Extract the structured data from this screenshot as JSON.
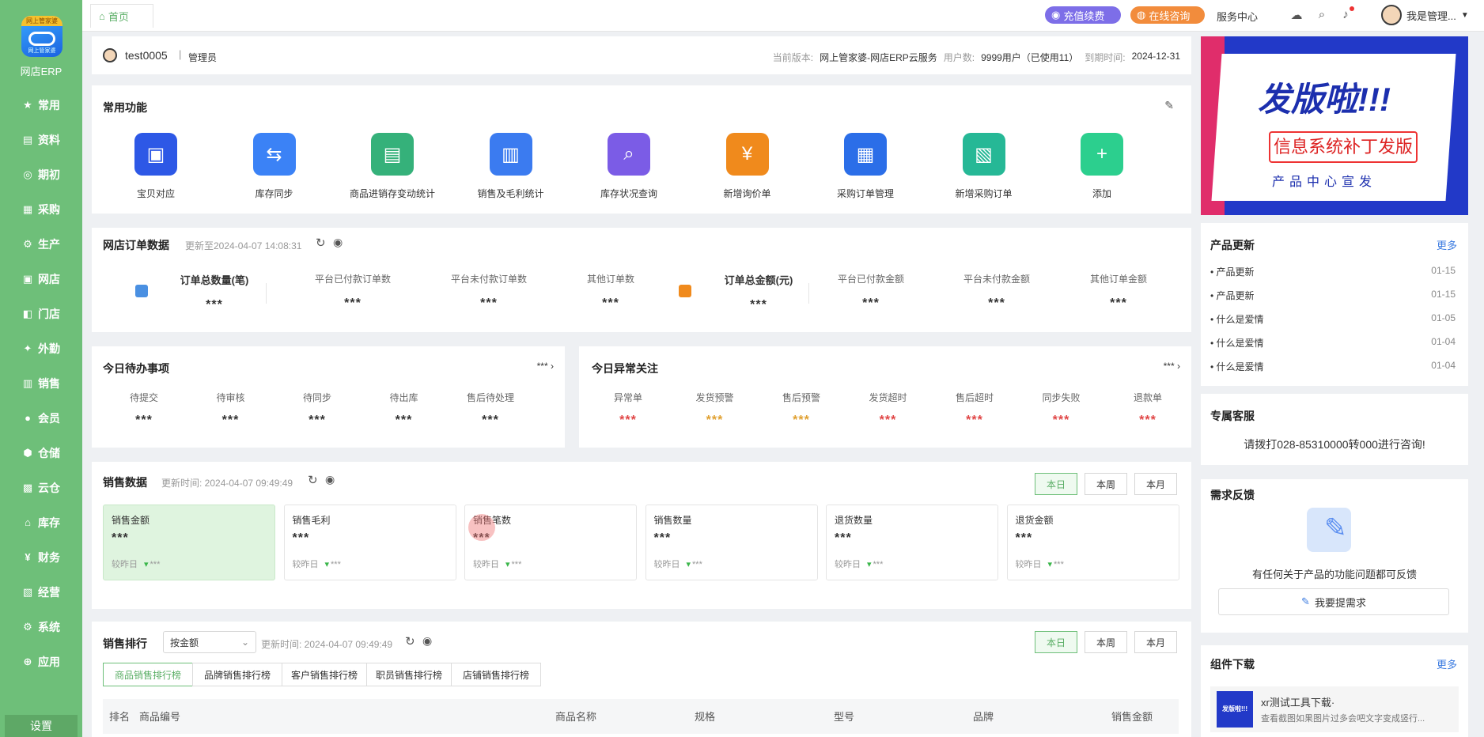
{
  "sidebar": {
    "logo_ribbon": "网上管家婆",
    "logo_sub": "网上管家婆",
    "logo_label": "网店ERP",
    "items": [
      {
        "icon": "★",
        "label": "常用"
      },
      {
        "icon": "▤",
        "label": "资料"
      },
      {
        "icon": "◎",
        "label": "期初"
      },
      {
        "icon": "▦",
        "label": "采购"
      },
      {
        "icon": "⚙",
        "label": "生产"
      },
      {
        "icon": "▣",
        "label": "网店"
      },
      {
        "icon": "◧",
        "label": "门店"
      },
      {
        "icon": "✦",
        "label": "外勤"
      },
      {
        "icon": "▥",
        "label": "销售"
      },
      {
        "icon": "●",
        "label": "会员"
      },
      {
        "icon": "⬢",
        "label": "仓储"
      },
      {
        "icon": "▩",
        "label": "云仓"
      },
      {
        "icon": "⌂",
        "label": "库存"
      },
      {
        "icon": "¥",
        "label": "财务"
      },
      {
        "icon": "▧",
        "label": "经营"
      },
      {
        "icon": "⚙",
        "label": "系统"
      },
      {
        "icon": "⊕",
        "label": "应用"
      }
    ],
    "settings": "设置"
  },
  "topbar": {
    "home_tab": "首页",
    "recharge": "充值续费",
    "consult": "在线咨询",
    "service_center": "服务中心",
    "user": "我是管理..."
  },
  "header": {
    "username": "test0005",
    "role": "管理员",
    "version_label": "当前版本:",
    "version_value": "网上管家婆-网店ERP云服务",
    "users_label": "用户数:",
    "users_value": "9999用户（已使用11）",
    "expiry_label": "到期时间:",
    "expiry_value": "2024-12-31"
  },
  "common_functions": {
    "title": "常用功能",
    "items": [
      {
        "label": "宝贝对应",
        "color": "#2d58e6",
        "icon": "▣"
      },
      {
        "label": "库存同步",
        "color": "#3b82f6",
        "icon": "⇆"
      },
      {
        "label": "商品进销存变动统计",
        "color": "#35b17a",
        "icon": "▤"
      },
      {
        "label": "销售及毛利统计",
        "color": "#3b7bf0",
        "icon": "▥"
      },
      {
        "label": "库存状况查询",
        "color": "#7b5ce6",
        "icon": "⌕"
      },
      {
        "label": "新增询价单",
        "color": "#f08a1c",
        "icon": "¥"
      },
      {
        "label": "采购订单管理",
        "color": "#2b6ee8",
        "icon": "▦"
      },
      {
        "label": "新增采购订单",
        "color": "#26b896",
        "icon": "▧"
      },
      {
        "label": "添加",
        "color": "#2ccf8e",
        "icon": "+"
      }
    ]
  },
  "shop_orders": {
    "title": "网店订单数据",
    "updated": "更新至2024-04-07 14:08:31",
    "count_title": "订单总数量(笔)",
    "count_value": "***",
    "count_cols": [
      {
        "label": "平台已付款订单数",
        "value": "***"
      },
      {
        "label": "平台未付款订单数",
        "value": "***"
      },
      {
        "label": "其他订单数",
        "value": "***"
      }
    ],
    "amount_title": "订单总金额(元)",
    "amount_value": "***",
    "amount_cols": [
      {
        "label": "平台已付款金额",
        "value": "***"
      },
      {
        "label": "平台未付款金额",
        "value": "***"
      },
      {
        "label": "其他订单金额",
        "value": "***"
      }
    ]
  },
  "todo": {
    "title": "今日待办事项",
    "more": "***",
    "items": [
      {
        "label": "待提交",
        "value": "***"
      },
      {
        "label": "待审核",
        "value": "***"
      },
      {
        "label": "待同步",
        "value": "***"
      },
      {
        "label": "待出库",
        "value": "***"
      },
      {
        "label": "售后待处理",
        "value": "***"
      }
    ]
  },
  "abnormal": {
    "title": "今日异常关注",
    "more": "***",
    "items": [
      {
        "label": "异常单",
        "value": "***",
        "color": "#e04545"
      },
      {
        "label": "发货预警",
        "value": "***",
        "color": "#e0a030"
      },
      {
        "label": "售后预警",
        "value": "***",
        "color": "#e0a030"
      },
      {
        "label": "发货超时",
        "value": "***",
        "color": "#e04545"
      },
      {
        "label": "售后超时",
        "value": "***",
        "color": "#e04545"
      },
      {
        "label": "同步失败",
        "value": "***",
        "color": "#e04545"
      },
      {
        "label": "退款单",
        "value": "***",
        "color": "#e04545"
      }
    ]
  },
  "sales": {
    "title": "销售数据",
    "updated": "更新时间: 2024-04-07 09:49:49",
    "ranges": [
      "本日",
      "本周",
      "本月"
    ],
    "cards": [
      {
        "label": "销售金额",
        "value": "***",
        "compare": "较昨日",
        "delta": "***"
      },
      {
        "label": "销售毛利",
        "value": "***",
        "compare": "较昨日",
        "delta": "***"
      },
      {
        "label": "销售笔数",
        "value": "***",
        "compare": "较昨日",
        "delta": "***"
      },
      {
        "label": "销售数量",
        "value": "***",
        "compare": "较昨日",
        "delta": "***"
      },
      {
        "label": "退货数量",
        "value": "***",
        "compare": "较昨日",
        "delta": "***"
      },
      {
        "label": "退货金额",
        "value": "***",
        "compare": "较昨日",
        "delta": "***"
      }
    ]
  },
  "ranking": {
    "title": "销售排行",
    "sort_select": "按金额",
    "updated": "更新时间: 2024-04-07 09:49:49",
    "ranges": [
      "本日",
      "本周",
      "本月"
    ],
    "tabs": [
      "商品销售排行榜",
      "品牌销售排行榜",
      "客户销售排行榜",
      "职员销售排行榜",
      "店铺销售排行榜"
    ],
    "columns": [
      "排名",
      "商品编号",
      "商品名称",
      "规格",
      "型号",
      "品牌",
      "销售金额"
    ]
  },
  "banner": {
    "headline": "发版啦!!!",
    "subtitle": "信息系统补丁发版",
    "caption": "产品中心宣发"
  },
  "product_updates": {
    "title": "产品更新",
    "more": "更多",
    "items": [
      {
        "label": "产品更新",
        "date": "01-15"
      },
      {
        "label": "产品更新",
        "date": "01-15"
      },
      {
        "label": "什么是爱情",
        "date": "01-05"
      },
      {
        "label": "什么是爱情",
        "date": "01-04"
      },
      {
        "label": "什么是爱情",
        "date": "01-04"
      }
    ]
  },
  "support": {
    "title": "专属客服",
    "text": "请拨打028-85310000转000进行咨询!"
  },
  "feedback": {
    "title": "需求反馈",
    "text": "有任何关于产品的功能问题都可反馈",
    "button": "我要提需求"
  },
  "downloads": {
    "title": "组件下载",
    "more": "更多",
    "item_title": "xr测试工具下载·",
    "item_desc": "查看截图如果图片过多会吧文字变成竖行...",
    "thumb_text": "发版啦!!!"
  }
}
